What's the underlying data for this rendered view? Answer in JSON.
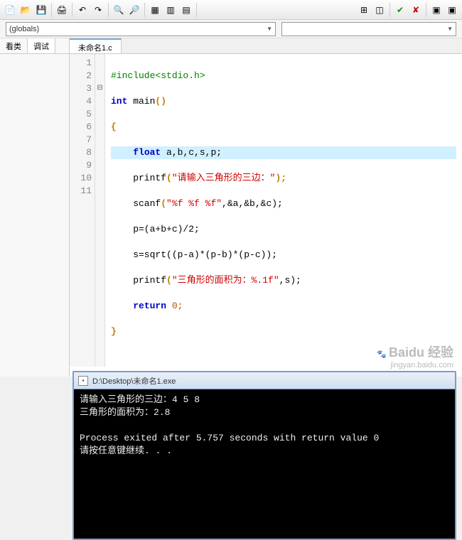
{
  "toolbar_icons": [
    "new",
    "open",
    "save",
    "saveall",
    "print",
    "undo",
    "redo",
    "find",
    "zoom-in",
    "zoom-out",
    "grid1",
    "grid2",
    "grid3",
    "layout",
    "tiles",
    "toggle",
    "check",
    "cross",
    "win1",
    "win2"
  ],
  "combo": {
    "left": "(globals)",
    "right": ""
  },
  "left_tabs": {
    "t0": "看类",
    "t1": "调试"
  },
  "filetab": "未命名1.c",
  "code": {
    "l1_a": "#include",
    "l1_b": "<stdio.h>",
    "l2_a": "int",
    "l2_b": " main",
    "l2_c": "()",
    "l3": "{",
    "l4_a": "float",
    "l4_b": " a,b,c,s,p;",
    "l5_a": "    printf",
    "l5_b": "(",
    "l5_c": "\"请输入三角形的三边：\"",
    "l5_d": ");",
    "l6_a": "    scanf",
    "l6_b": "(",
    "l6_c": "\"%f %f %f\"",
    "l6_d": ",&a,&b,&c);",
    "l7": "    p=(a+b+c)/2;",
    "l8": "    s=sqrt((p-a)*(p-b)*(p-c));",
    "l9_a": "    printf",
    "l9_b": "(",
    "l9_c": "\"三角形的面积为：%.1f\"",
    "l9_d": ",s);",
    "l10_a": "return",
    "l10_b": " 0;",
    "l11": "}"
  },
  "console": {
    "title": "D:\\Desktop\\未命名1.exe",
    "line1": "请输入三角形的三边：4 5 8",
    "line2": "三角形的面积为：2.8",
    "line3": "",
    "line4": "Process exited after 5.757 seconds with return value 0",
    "line5": "请按任意键继续. . ."
  },
  "watermark": {
    "brand": "Baidu 经验",
    "url": "jingyan.baidu.com"
  }
}
